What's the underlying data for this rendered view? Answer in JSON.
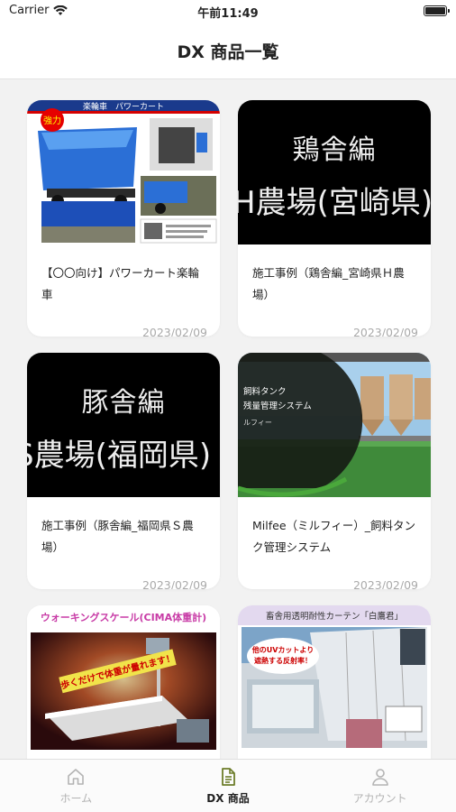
{
  "status_bar": {
    "carrier": "Carrier",
    "time": "午前11:49"
  },
  "header": {
    "title": "DX 商品一覧"
  },
  "products": [
    {
      "title": "【〇〇向け】パワーカート楽輪車",
      "date": "2023/02/09"
    },
    {
      "title": "施工事例（鶏舎編_宮崎県Ｈ農場）",
      "date": "2023/02/09",
      "thumb_line1": "鶏舎編",
      "thumb_line2": "H農場(宮崎県)"
    },
    {
      "title": "施工事例（豚舎編_福岡県Ｓ農場）",
      "date": "2023/02/09",
      "thumb_line1": "豚舎編",
      "thumb_line2": "S農場(福岡県)"
    },
    {
      "title": "Milfee（ミルフィー）_飼料タンク管理システム",
      "date": "2023/02/09"
    },
    {
      "title": "",
      "date": ""
    },
    {
      "title": "",
      "date": ""
    }
  ],
  "thumb_text": {
    "cart_banner": "楽輪車　パワーカート",
    "cart_badge": "強力",
    "milfee_line1": "飼料タンク",
    "milfee_line2": "残量管理システム",
    "milfee_line3": "ルフィー",
    "scale_banner": "ウォーキングスケール(CIMA体重計)",
    "scale_caption": "歩くだけで体重が量れます！",
    "curtain_banner": "畜舎用透明耐性カーテン「白鷹君」",
    "curtain_caption1": "他のUVカットより",
    "curtain_caption2": "遮熱する反射率！"
  },
  "tabs": [
    {
      "label": "ホーム",
      "icon": "home-icon",
      "active": false
    },
    {
      "label": "DX 商品",
      "icon": "document-icon",
      "active": true
    },
    {
      "label": "アカウント",
      "icon": "person-icon",
      "active": false
    }
  ],
  "colors": {
    "active_tab_icon": "#6d7d2a",
    "inactive_tab": "#b3b3b3",
    "background": "#f2f2f2"
  }
}
